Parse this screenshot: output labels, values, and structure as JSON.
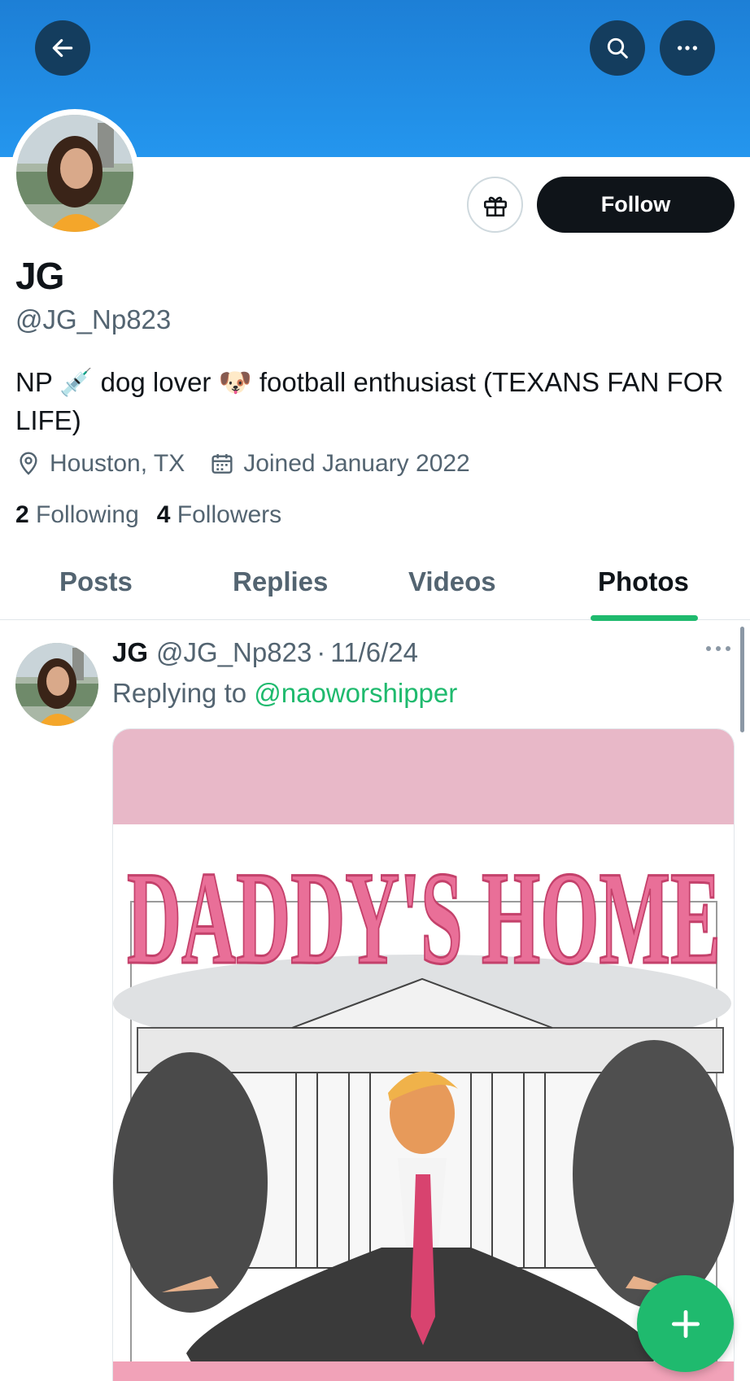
{
  "header": {
    "back_icon": "arrow-left-icon",
    "search_icon": "search-icon",
    "more_icon": "more-horizontal-icon",
    "banner_color": "#1d7fd6"
  },
  "profile": {
    "display_name": "JG",
    "handle": "@JG_Np823",
    "bio": "NP 💉 dog lover 🐶 football enthusiast (TEXANS FAN FOR LIFE)",
    "location": "Houston, TX",
    "joined": "Joined January 2022",
    "following_count": "2",
    "following_label": "Following",
    "followers_count": "4",
    "followers_label": "Followers",
    "follow_label": "Follow",
    "gift_icon": "gift-icon"
  },
  "tabs": [
    {
      "label": "Posts",
      "active": false
    },
    {
      "label": "Replies",
      "active": false
    },
    {
      "label": "Videos",
      "active": false
    },
    {
      "label": "Photos",
      "active": true
    }
  ],
  "post": {
    "author": "JG",
    "handle": "@JG_Np823",
    "separator": "·",
    "date": "11/6/24",
    "replying_prefix": "Replying to",
    "replying_to": "@naoworshipper",
    "image_headline": "DADDY'S HOME"
  },
  "fab": {
    "icon": "plus-icon",
    "color": "#1fba6e"
  }
}
